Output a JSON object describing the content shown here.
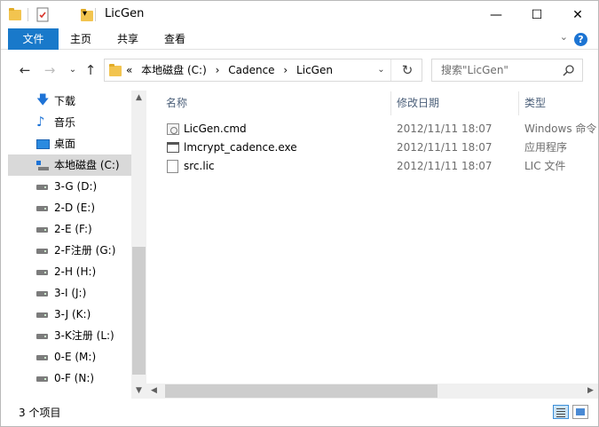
{
  "window": {
    "title": "LicGen",
    "controls": {
      "minimize": "—",
      "maximize": "☐",
      "close": "✕"
    }
  },
  "ribbon": {
    "tabs": [
      {
        "label": "文件"
      },
      {
        "label": "主页"
      },
      {
        "label": "共享"
      },
      {
        "label": "查看"
      }
    ]
  },
  "address": {
    "overflow": "«",
    "crumbs": [
      "本地磁盘 (C:)",
      "›",
      "Cadence",
      "›",
      "LicGen"
    ],
    "search_placeholder": "搜索\"LicGen\""
  },
  "nav": {
    "items": [
      {
        "label": "下载",
        "icon": "download-icon"
      },
      {
        "label": "音乐",
        "icon": "music-icon"
      },
      {
        "label": "桌面",
        "icon": "desktop-icon"
      },
      {
        "label": "本地磁盘 (C:)",
        "icon": "local-disk-icon",
        "selected": true
      },
      {
        "label": "3-G (D:)",
        "icon": "drive-icon"
      },
      {
        "label": "2-D (E:)",
        "icon": "drive-icon"
      },
      {
        "label": "2-E (F:)",
        "icon": "drive-icon"
      },
      {
        "label": "2-F注册 (G:)",
        "icon": "drive-icon"
      },
      {
        "label": "2-H (H:)",
        "icon": "drive-icon"
      },
      {
        "label": "3-I (J:)",
        "icon": "drive-icon"
      },
      {
        "label": "3-J (K:)",
        "icon": "drive-icon"
      },
      {
        "label": "3-K注册 (L:)",
        "icon": "drive-icon"
      },
      {
        "label": "0-E (M:)",
        "icon": "drive-icon"
      },
      {
        "label": "0-F (N:)",
        "icon": "drive-icon"
      }
    ]
  },
  "columns": {
    "name": "名称",
    "date": "修改日期",
    "type": "类型"
  },
  "files": [
    {
      "name": "LicGen.cmd",
      "date": "2012/11/11 18:07",
      "type": "Windows 命令",
      "icon": "cmd-file-icon"
    },
    {
      "name": "lmcrypt_cadence.exe",
      "date": "2012/11/11 18:07",
      "type": "应用程序",
      "icon": "exe-file-icon"
    },
    {
      "name": "src.lic",
      "date": "2012/11/11 18:07",
      "type": "LIC 文件",
      "icon": "file-icon"
    }
  ],
  "status": {
    "count": "3 个项目"
  },
  "colors": {
    "accent": "#1979ca",
    "selected_bg": "#d9d9d9",
    "header_text": "#4c607a"
  }
}
